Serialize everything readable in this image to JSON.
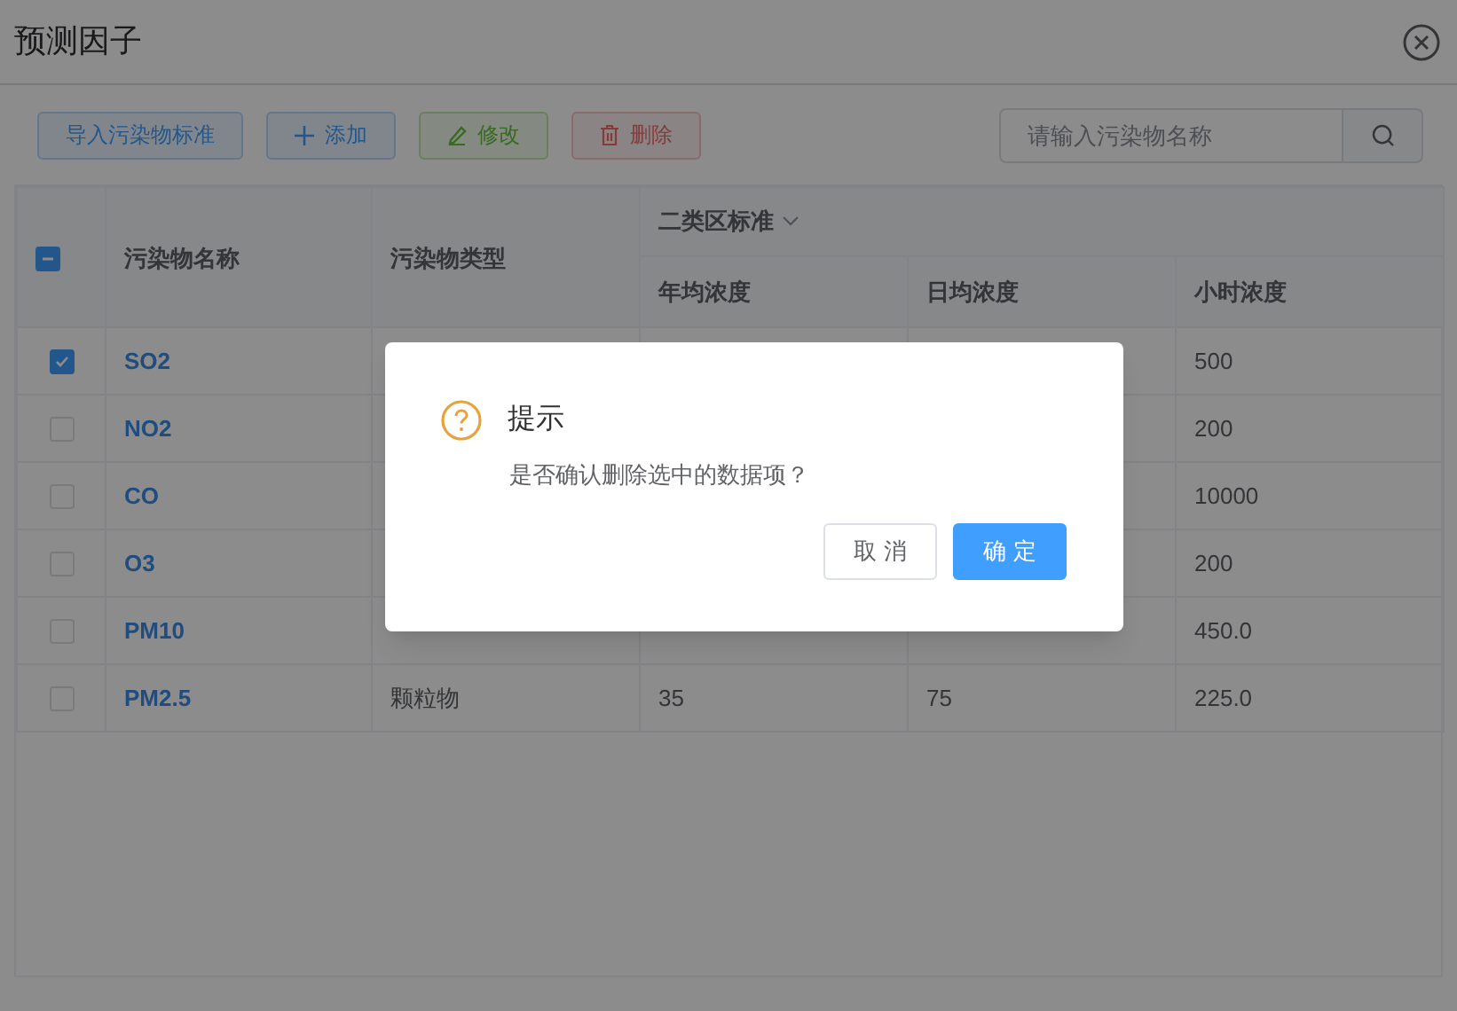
{
  "window": {
    "title": "预测因子"
  },
  "toolbar": {
    "buttons": [
      {
        "kind": "import",
        "label": "导入污染物标准"
      },
      {
        "kind": "add",
        "label": "添加"
      },
      {
        "kind": "edit",
        "label": "修改"
      },
      {
        "kind": "delete",
        "label": "删除"
      }
    ],
    "search": {
      "placeholder": "请输入污染物名称"
    }
  },
  "table": {
    "select_all": {
      "indeterminate": true
    },
    "columns": [
      "污染物名称",
      "污染物类型"
    ],
    "group": {
      "label": "二类区标准",
      "columns": [
        "年均浓度",
        "日均浓度",
        "小时浓度"
      ]
    },
    "rows": [
      {
        "checked": true,
        "name": "SO2",
        "hourly": "500"
      },
      {
        "checked": false,
        "name": "NO2",
        "hourly": "200"
      },
      {
        "checked": false,
        "name": "CO",
        "hourly": "10000"
      },
      {
        "checked": false,
        "name": "O3",
        "hourly": "200"
      },
      {
        "checked": false,
        "name": "PM10",
        "hourly": "450.0"
      },
      {
        "checked": false,
        "name": "PM2.5",
        "type": "颗粒物",
        "annual": "35",
        "daily": "75",
        "hourly": "225.0"
      }
    ]
  },
  "message_box": {
    "title": "提示",
    "message": "是否确认删除选中的数据项？",
    "buttons": [
      {
        "kind": "cancel",
        "label": "取 消"
      },
      {
        "kind": "confirm",
        "label": "确 定"
      }
    ]
  }
}
